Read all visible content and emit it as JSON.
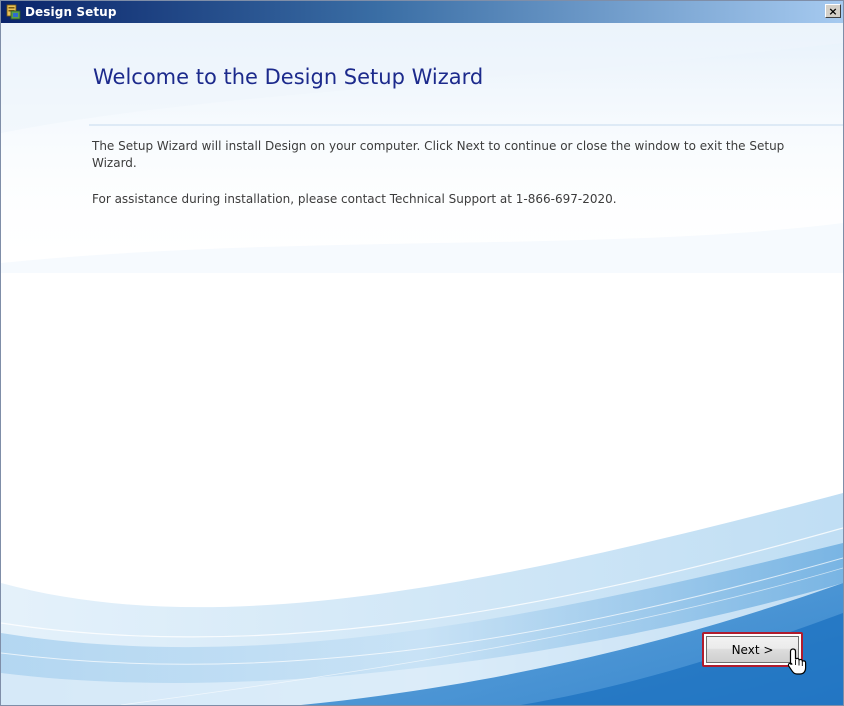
{
  "window": {
    "title": "Design Setup",
    "close_label": "×"
  },
  "main": {
    "heading": "Welcome to the Design Setup Wizard",
    "paragraphs": [
      "The Setup Wizard will install Design on your computer. Click Next to continue or close the window to exit the Setup Wizard.",
      "For assistance during installation, please contact Technical Support at 1-866-697-2020."
    ]
  },
  "buttons": {
    "next_label": "Next >"
  },
  "icons": {
    "app": "installer-icon",
    "close": "close-icon",
    "cursor": "hand-pointer-icon"
  },
  "colors": {
    "heading": "#1c2a8c",
    "titlebar_start": "#0a246a",
    "titlebar_end": "#a6caf0",
    "focus_border": "#b01c2e"
  }
}
